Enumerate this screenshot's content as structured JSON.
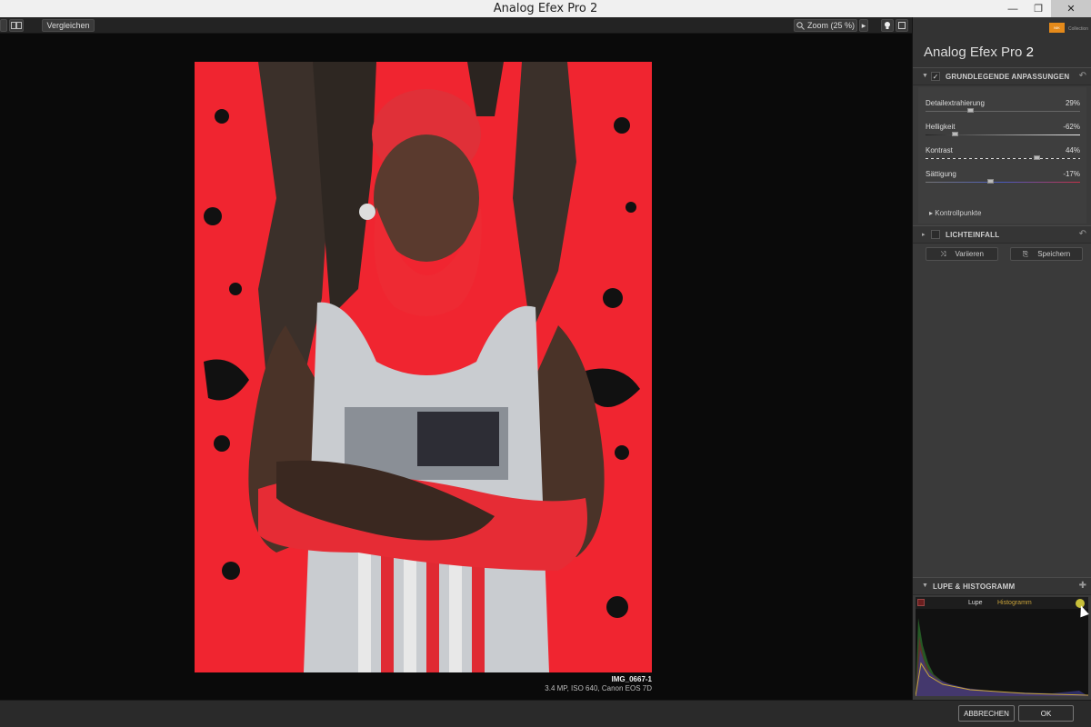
{
  "window": {
    "title": "Analog Efex Pro 2",
    "min_glyph": "—",
    "max_glyph": "❐",
    "close_glyph": "✕"
  },
  "toolbar": {
    "compare_label": "Vergleichen",
    "zoom_label": "Zoom (25 %)",
    "zoom_arrow": "▸"
  },
  "image": {
    "name": "IMG_0667-1",
    "info": "3.4 MP, ISO 640, Canon EOS 7D"
  },
  "panel": {
    "app_name": "Analog Efex Pro",
    "app_version": "2",
    "logo_text": "NIK",
    "logo_tag": "Collection",
    "basic": {
      "title": "GRUNDLEGENDE ANPASSUNGEN",
      "checked": "✓",
      "sliders": [
        {
          "label": "Detailextrahierung",
          "value": "29%",
          "level": 0.29
        },
        {
          "label": "Helligkeit",
          "value": "-62%",
          "level": 0.19
        },
        {
          "label": "Kontrast",
          "value": "44%",
          "level": 0.72
        },
        {
          "label": "Sättigung",
          "value": "-17%",
          "level": 0.415
        }
      ],
      "control_points": "Kontrollpunkte"
    },
    "light": {
      "title": "LICHTEINFALL"
    },
    "vary_label": "Variieren",
    "save_label": "Speichern",
    "loupe": {
      "title": "LUPE & HISTOGRAMM",
      "tab_loupe": "Lupe",
      "tab_histogram": "Histogramm"
    }
  },
  "footer": {
    "cancel_label": "ABBRECHEN",
    "ok_label": "OK"
  },
  "colors": {
    "accent_red": "#f02530",
    "histogram_tab_active": "#c8a23a",
    "logo_orange": "#e58a1a"
  }
}
